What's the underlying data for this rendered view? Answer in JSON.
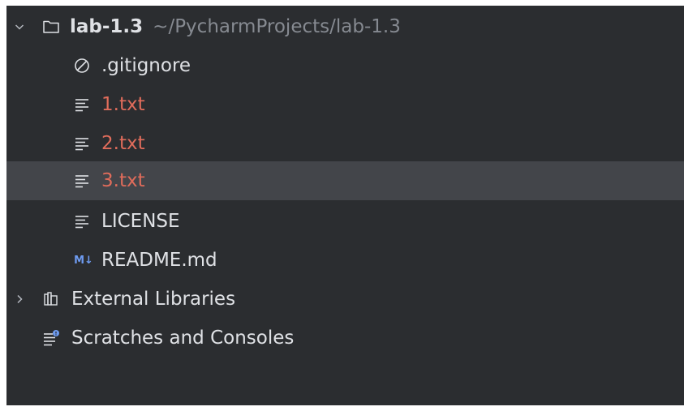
{
  "tree": {
    "project": {
      "name": "lab-1.3",
      "path": "~/PycharmProjects/lab-1.3",
      "expand_icon": "chevron-down-icon",
      "icon": "folder-icon"
    },
    "files": [
      {
        "label": ".gitignore",
        "icon": "ignored-file-icon",
        "status": "normal"
      },
      {
        "label": "1.txt",
        "icon": "text-file-icon",
        "status": "untracked"
      },
      {
        "label": "2.txt",
        "icon": "text-file-icon",
        "status": "untracked"
      },
      {
        "label": "3.txt",
        "icon": "text-file-icon",
        "status": "untracked",
        "selected": true
      },
      {
        "label": "LICENSE",
        "icon": "text-file-icon",
        "status": "normal"
      },
      {
        "label": "README.md",
        "icon": "markdown-file-icon",
        "icon_text": "M↓",
        "status": "normal"
      }
    ],
    "external_libraries": {
      "label": "External Libraries",
      "icon": "library-icon",
      "expand_icon": "chevron-right-icon"
    },
    "scratches": {
      "label": "Scratches and Consoles",
      "icon": "scratches-icon"
    }
  },
  "colors": {
    "background": "#2b2d30",
    "selection": "#43454a",
    "text": "#dfe1e5",
    "untracked": "#e06c5b",
    "path": "#868a91",
    "markdown_icon": "#6e9bf0"
  }
}
